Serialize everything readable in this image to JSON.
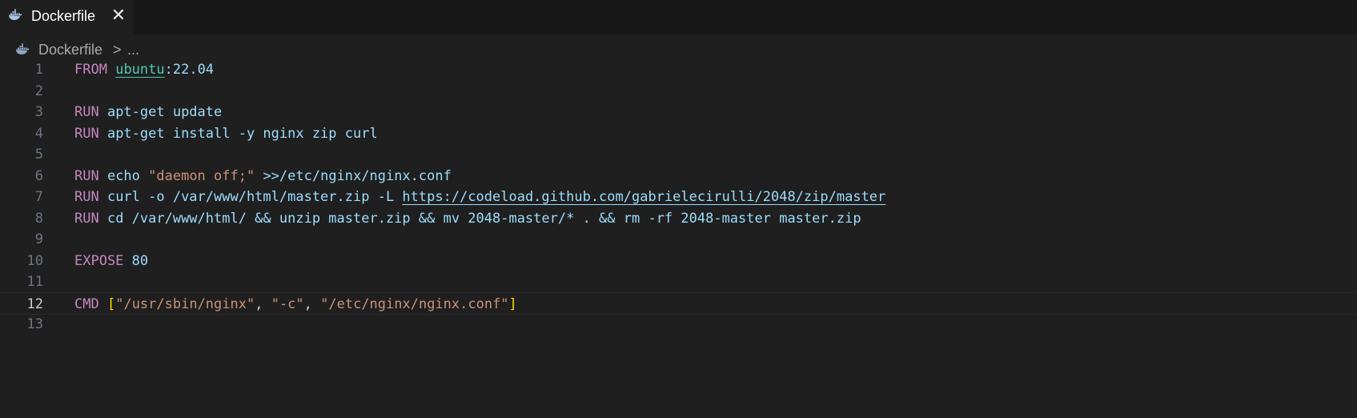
{
  "tab": {
    "icon": "docker-whale-icon",
    "label": "Dockerfile",
    "close_glyph": "✕"
  },
  "breadcrumb": {
    "icon": "docker-whale-icon",
    "file": "Dockerfile",
    "separator": ">",
    "more": "..."
  },
  "editor": {
    "current_line": 12,
    "lines": [
      {
        "n": "1",
        "t": [
          {
            "c": "kw",
            "v": "FROM"
          },
          {
            "c": "",
            "v": " "
          },
          {
            "c": "img",
            "v": "ubuntu"
          },
          {
            "c": "",
            "v": ":22.04"
          }
        ]
      },
      {
        "n": "2",
        "t": []
      },
      {
        "n": "3",
        "t": [
          {
            "c": "kw",
            "v": "RUN"
          },
          {
            "c": "",
            "v": " apt-get update"
          }
        ]
      },
      {
        "n": "4",
        "t": [
          {
            "c": "kw",
            "v": "RUN"
          },
          {
            "c": "",
            "v": " apt-get install -y nginx zip curl"
          }
        ]
      },
      {
        "n": "5",
        "t": []
      },
      {
        "n": "6",
        "t": [
          {
            "c": "kw",
            "v": "RUN"
          },
          {
            "c": "",
            "v": " echo "
          },
          {
            "c": "str",
            "v": "\"daemon off;\""
          },
          {
            "c": "",
            "v": " >>/etc/nginx/nginx.conf"
          }
        ]
      },
      {
        "n": "7",
        "t": [
          {
            "c": "kw",
            "v": "RUN"
          },
          {
            "c": "",
            "v": " curl -o /var/www/html/master.zip -L "
          },
          {
            "c": "link",
            "v": "https://codeload.github.com/gabrielecirulli/2048/zip/master"
          }
        ]
      },
      {
        "n": "8",
        "t": [
          {
            "c": "kw",
            "v": "RUN"
          },
          {
            "c": "",
            "v": " cd /var/www/html/ && unzip master.zip && mv 2048-master/* . && rm -rf 2048-master master.zip"
          }
        ]
      },
      {
        "n": "9",
        "t": []
      },
      {
        "n": "10",
        "t": [
          {
            "c": "kw",
            "v": "EXPOSE"
          },
          {
            "c": "",
            "v": " 80"
          }
        ]
      },
      {
        "n": "11",
        "t": []
      },
      {
        "n": "12",
        "t": [
          {
            "c": "kw",
            "v": "CMD"
          },
          {
            "c": "",
            "v": " "
          },
          {
            "c": "brk",
            "v": "["
          },
          {
            "c": "str",
            "v": "\"/usr/sbin/nginx\""
          },
          {
            "c": "punc",
            "v": ", "
          },
          {
            "c": "str",
            "v": "\"-c\""
          },
          {
            "c": "punc",
            "v": ", "
          },
          {
            "c": "str",
            "v": "\"/etc/nginx/nginx.conf\""
          },
          {
            "c": "brk",
            "v": "]"
          }
        ]
      },
      {
        "n": "13",
        "t": []
      }
    ]
  },
  "colors": {
    "keyword": "#c586c0",
    "image": "#4ec9b0",
    "string": "#ce9178",
    "text": "#9cdcfe",
    "bracket": "#ffd700",
    "background": "#1f1f1f"
  }
}
